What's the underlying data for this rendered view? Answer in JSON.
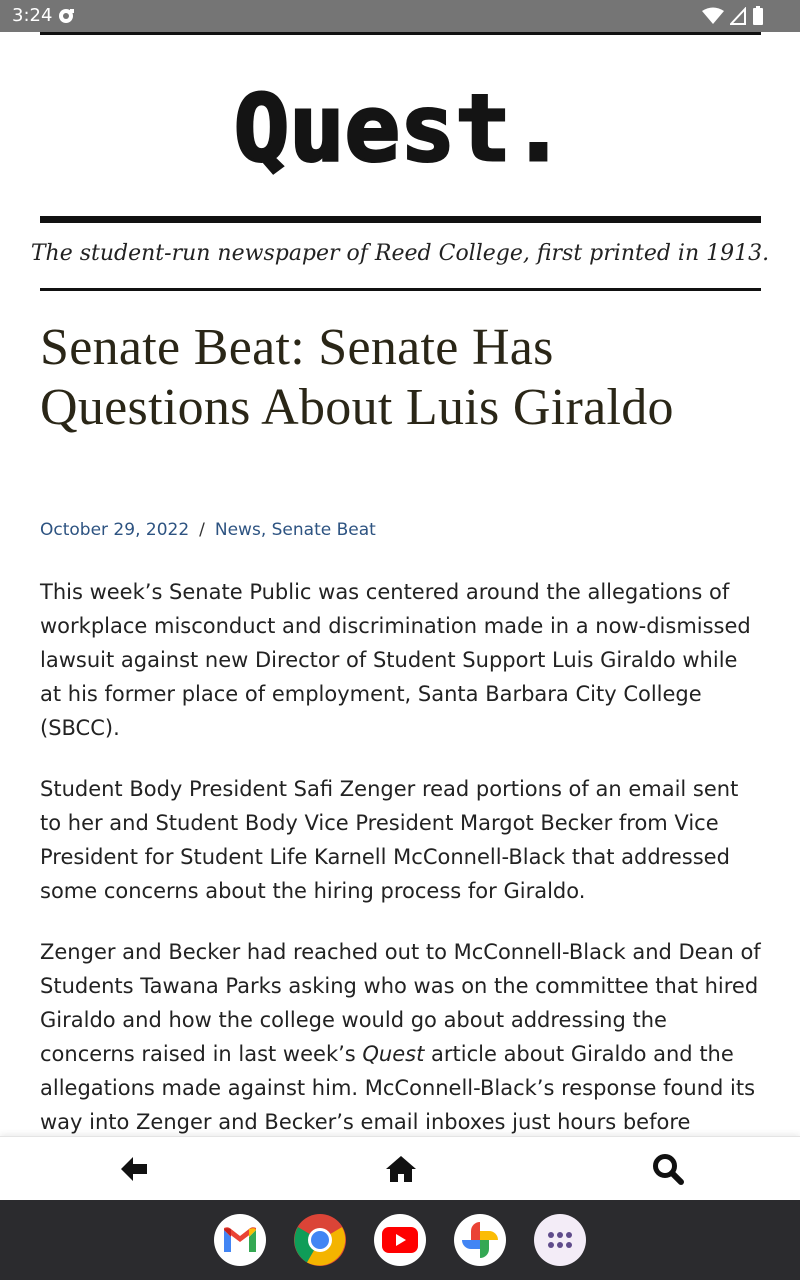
{
  "status_bar": {
    "time": "3:24",
    "icons": [
      "notification-icon",
      "wifi-icon",
      "signal-icon",
      "battery-icon"
    ]
  },
  "header": {
    "logo_text": "Quest.",
    "tagline": "The student-run newspaper of Reed College, first printed in 1913."
  },
  "article": {
    "title": "Senate Beat: Senate Has Questions About Luis Giraldo",
    "date": "October 29, 2022",
    "separator": "/",
    "categories": [
      "News",
      "Senate Beat"
    ],
    "category_separator": ",",
    "paragraphs": [
      "This week’s Senate Public was centered around the allegations of workplace misconduct and discrimination made in a now-dismissed lawsuit against new Director of Student Support Luis Giraldo while at his former place of employment, Santa Barbara City College (SBCC).",
      "Student Body President Safi Zenger read portions of an email sent to her and Student Body Vice President Margot Becker from Vice President for Student Life Karnell McConnell-Black that addressed some concerns about the hiring process for Giraldo."
    ],
    "p3": {
      "before": "Zenger and Becker had reached out to McConnell-Black and Dean of Students Tawana Parks asking who was on the committee that hired Giraldo and how the college would go about addressing the concerns raised in last week’s ",
      "emphasis": "Quest",
      "after": " article about Giraldo and the allegations made against him. McConnell-Black’s response found its way into Zenger and Becker’s email inboxes just hours before"
    }
  },
  "bottom_nav": {
    "icons": [
      "back-arrow-icon",
      "home-icon",
      "search-icon"
    ]
  },
  "dock": {
    "apps": [
      "gmail-icon",
      "chrome-icon",
      "youtube-icon",
      "photos-icon",
      "app-drawer-icon"
    ]
  },
  "colors": {
    "status_bar": "#757575",
    "headline": "#2a2617",
    "link": "#2d5381",
    "dock": "#2b2b2e"
  }
}
